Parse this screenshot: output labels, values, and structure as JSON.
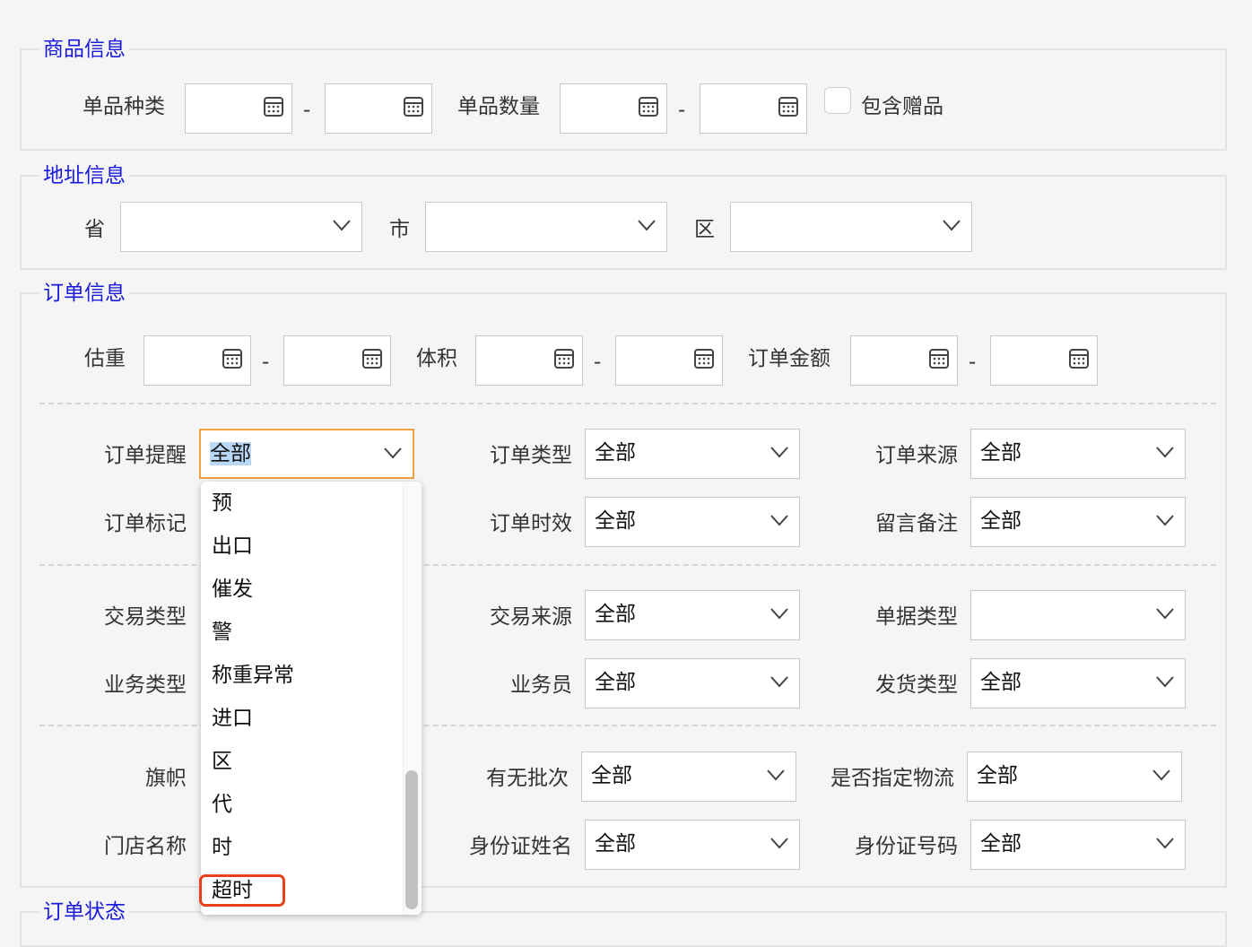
{
  "sections": {
    "product": {
      "legend": "商品信息",
      "item_kind_label": "单品种类",
      "item_qty_label": "单品数量",
      "range_sep": "-",
      "include_gift_label": "包含赠品"
    },
    "address": {
      "legend": "地址信息",
      "province_label": "省",
      "city_label": "市",
      "district_label": "区"
    },
    "order": {
      "legend": "订单信息",
      "weight_label": "估重",
      "volume_label": "体积",
      "amount_label": "订单金额",
      "range_sep": "-",
      "fields": {
        "reminder": {
          "label": "订单提醒",
          "value": "全部"
        },
        "type": {
          "label": "订单类型",
          "value": "全部"
        },
        "source": {
          "label": "订单来源",
          "value": "全部"
        },
        "mark": {
          "label": "订单标记"
        },
        "timeliness": {
          "label": "订单时效",
          "value": "全部"
        },
        "remark": {
          "label": "留言备注",
          "value": "全部"
        },
        "trade_type": {
          "label": "交易类型"
        },
        "trade_source": {
          "label": "交易来源",
          "value": "全部"
        },
        "doc_type": {
          "label": "单据类型",
          "value": ""
        },
        "biz_type": {
          "label": "业务类型"
        },
        "salesman": {
          "label": "业务员",
          "value": "全部"
        },
        "ship_type": {
          "label": "发货类型",
          "value": "全部"
        },
        "flag": {
          "label": "旗帜"
        },
        "batch": {
          "label": "有无批次",
          "value": "全部"
        },
        "logistics": {
          "label": "是否指定物流",
          "value": "全部"
        },
        "store": {
          "label": "门店名称"
        },
        "id_name": {
          "label": "身份证姓名",
          "value": "全部"
        },
        "id_number": {
          "label": "身份证号码",
          "value": "全部"
        }
      }
    },
    "status": {
      "legend": "订单状态"
    }
  },
  "dropdown": {
    "options": [
      "预",
      "出口",
      "催发",
      "警",
      "称重异常",
      "进口",
      "区",
      "代",
      "时",
      "超时"
    ],
    "highlighted": "超时"
  },
  "colors": {
    "legend": "#1a1adb",
    "focus_border": "#f0a040",
    "highlight": "#e8401c",
    "selection": "#b9d7f7"
  }
}
